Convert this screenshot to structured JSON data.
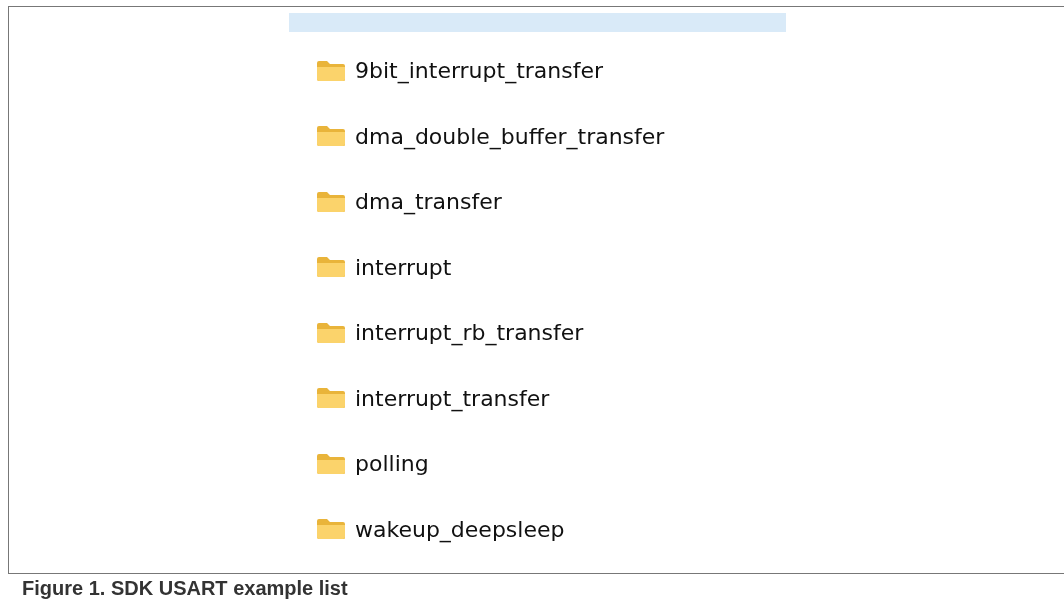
{
  "folder_list": {
    "items": [
      {
        "name": "9bit_interrupt_transfer"
      },
      {
        "name": "dma_double_buffer_transfer"
      },
      {
        "name": "dma_transfer"
      },
      {
        "name": "interrupt"
      },
      {
        "name": "interrupt_rb_transfer"
      },
      {
        "name": "interrupt_transfer"
      },
      {
        "name": "polling"
      },
      {
        "name": "wakeup_deepsleep"
      }
    ]
  },
  "caption": "Figure 1.  SDK USART example list"
}
